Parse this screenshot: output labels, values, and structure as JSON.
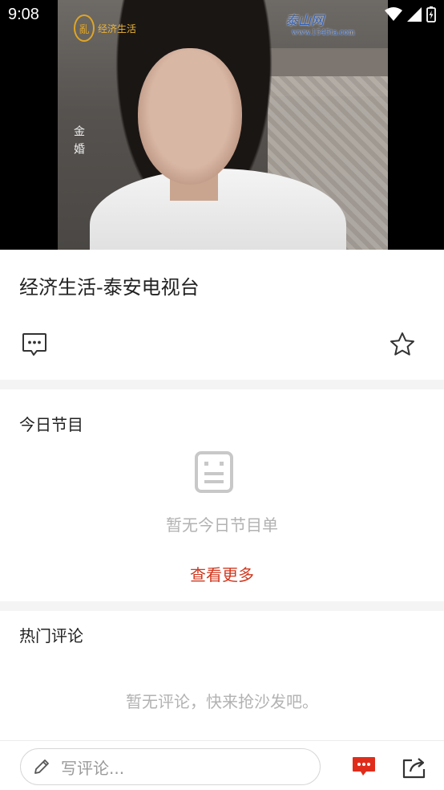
{
  "status_bar": {
    "time": "9:08"
  },
  "video": {
    "station_logo_text": "经济生活",
    "on_screen_caption": "金婚",
    "watermark": "泰山网",
    "watermark_url": "www.1545ta.com"
  },
  "channel": {
    "title": "经济生活-泰安电视台"
  },
  "today_program": {
    "heading": "今日节目",
    "empty_text": "暂无今日节目单",
    "more_label": "查看更多"
  },
  "hot_comments": {
    "heading": "热门评论",
    "empty_text": "暂无评论，快来抢沙发吧。"
  },
  "bottom_bar": {
    "input_placeholder": "写评论..."
  },
  "colors": {
    "accent": "#d0381f",
    "muted": "#b2b2b2",
    "divider": "#f4f4f4"
  },
  "icons": [
    "comment-icon",
    "star-icon",
    "document-icon",
    "pencil-icon",
    "comments-bubble-icon",
    "share-icon",
    "wifi-icon",
    "signal-icon",
    "battery-icon"
  ]
}
